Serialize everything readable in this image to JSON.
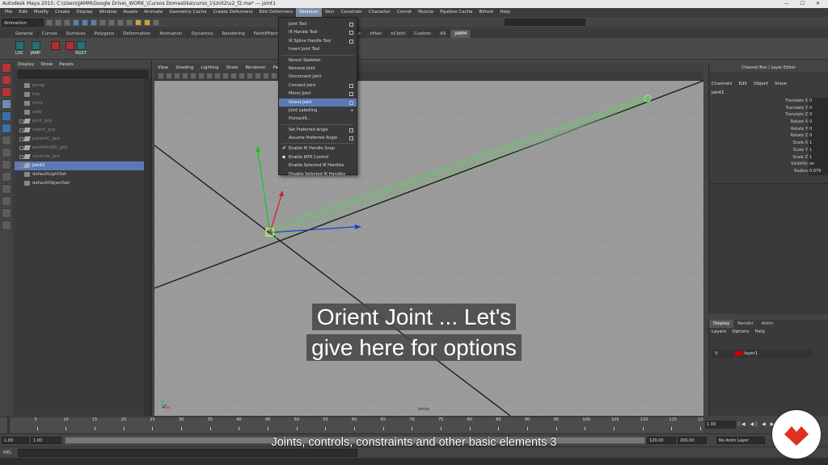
{
  "window": {
    "title": "Autodesk Maya 2015: C:\\Users\\JAMM\\Google Drive\\_WORK_\\Cursos Domestika\\curso_1\\Unit2\\u2_f2.ma* --- joint1"
  },
  "menubar": [
    "File",
    "Edit",
    "Modify",
    "Create",
    "Display",
    "Window",
    "Assets",
    "Animate",
    "Geometry Cache",
    "Create Deformers",
    "Edit Deformers",
    "Skeleton",
    "Skin",
    "Constrain",
    "Character",
    "Comet",
    "Muscle",
    "Pipeline Cache",
    "Bifrost",
    "Help"
  ],
  "menubar_active": "Skeleton",
  "status": {
    "mode": "Animation"
  },
  "shelf_tabs": [
    "General",
    "Curves",
    "Surfaces",
    "Polygons",
    "Deformation",
    "Animation",
    "Dynamics",
    "Rendering",
    "PaintEffects",
    "Toon",
    "Muscle",
    "Fluids",
    "Fur",
    "nHair",
    "nCloth",
    "Custom",
    "AS",
    "JAMM"
  ],
  "shelf_tab_active": "JAMM",
  "shelf_buttons": [
    "LOC",
    "JAMP",
    "",
    "",
    "RGST"
  ],
  "outliner": {
    "menu": [
      "Display",
      "Show",
      "Panels"
    ],
    "items": [
      {
        "label": "persp",
        "dim": true,
        "expand": false
      },
      {
        "label": "top",
        "dim": true,
        "expand": false
      },
      {
        "label": "front",
        "dim": true,
        "expand": false
      },
      {
        "label": "side",
        "dim": true,
        "expand": false
      },
      {
        "label": "joint_grp",
        "dim": true,
        "expand": true
      },
      {
        "label": "orient_grp",
        "dim": true,
        "expand": true
      },
      {
        "label": "parentC_grp",
        "dim": true,
        "expand": true
      },
      {
        "label": "pointAndOr_grp",
        "dim": true,
        "expand": true
      },
      {
        "label": "controls_grp",
        "dim": true,
        "expand": true
      },
      {
        "label": "joint1",
        "dim": false,
        "expand": true,
        "selected": true
      },
      {
        "label": "defaultLightSet",
        "dim": false,
        "expand": false
      },
      {
        "label": "defaultObjectSet",
        "dim": false,
        "expand": false
      }
    ]
  },
  "viewport": {
    "menu": [
      "View",
      "Shading",
      "Lighting",
      "Show",
      "Renderer",
      "Panels"
    ],
    "camera_label": "persp"
  },
  "skeleton_menu": [
    {
      "label": "Joint Tool",
      "option": true
    },
    {
      "label": "IK Handle Tool",
      "option": true
    },
    {
      "label": "IK Spline Handle Tool",
      "option": true
    },
    {
      "label": "Insert Joint Tool",
      "option": false
    },
    {
      "sep": true
    },
    {
      "label": "Reroot Skeleton",
      "option": false
    },
    {
      "label": "Remove Joint",
      "option": false
    },
    {
      "label": "Disconnect Joint",
      "option": false
    },
    {
      "label": "Connect Joint",
      "option": true
    },
    {
      "label": "Mirror Joint",
      "option": true
    },
    {
      "label": "Orient Joint",
      "option": true,
      "selected": true
    },
    {
      "label": "Joint Labelling",
      "submenu": true
    },
    {
      "label": "HumanIK...",
      "option": false
    },
    {
      "sep": true
    },
    {
      "label": "Set Preferred Angle",
      "option": true
    },
    {
      "label": "Assume Preferred Angle",
      "option": true
    },
    {
      "sep": true
    },
    {
      "label": "Enable IK Handle Snap",
      "check": true
    },
    {
      "label": "Enable IKFK Control",
      "check": false
    },
    {
      "label": "Enable Selected IK Handles",
      "option": false
    },
    {
      "label": "Disable Selected IK Handles",
      "option": false
    }
  ],
  "channel_box": {
    "header": "Channel Box / Layer Editor",
    "menu": [
      "Channels",
      "Edit",
      "Object",
      "Show"
    ],
    "object": "joint1",
    "attrs": [
      {
        "name": "Translate X",
        "value": "0"
      },
      {
        "name": "Translate Y",
        "value": "0"
      },
      {
        "name": "Translate Z",
        "value": "0"
      },
      {
        "name": "Rotate X",
        "value": "0"
      },
      {
        "name": "Rotate Y",
        "value": "0"
      },
      {
        "name": "Rotate Z",
        "value": "0"
      },
      {
        "name": "Scale X",
        "value": "1"
      },
      {
        "name": "Scale Y",
        "value": "1"
      },
      {
        "name": "Scale Z",
        "value": "1"
      },
      {
        "name": "Visibility",
        "value": "on"
      },
      {
        "name": "Radius",
        "value": "0.879"
      }
    ]
  },
  "layer_editor": {
    "tabs": [
      "Display",
      "Render",
      "Anim"
    ],
    "tab_active": "Display",
    "menu": [
      "Layers",
      "Options",
      "Help"
    ],
    "layer": {
      "visible": "V",
      "name": "layer1",
      "color": "#cc0000"
    }
  },
  "timeline": {
    "ticks": [
      "5",
      "10",
      "15",
      "20",
      "25",
      "30",
      "35",
      "40",
      "45",
      "50",
      "55",
      "60",
      "65",
      "70",
      "75",
      "80",
      "85",
      "90",
      "95",
      "100",
      "105",
      "110",
      "115",
      "120"
    ],
    "current": "1.00"
  },
  "range": {
    "start": "1.00",
    "start2": "1.00",
    "marker": "1",
    "end": "120.00",
    "end2": "200.00",
    "anim_layer": "No Anim Layer",
    "char_set": "No Character Set"
  },
  "mel_label": "MEL",
  "caption": {
    "line1": "Orient Joint ... Let's",
    "line2": "give here for options"
  },
  "subtitle": "Joints, controls, constraints and other basic elements 3",
  "colors": {
    "menu_highlight": "#5b7ab5",
    "viewport_bg": "#9a9a9a",
    "joint_green": "#4fdc4f",
    "logo_red": "#e0301e"
  }
}
